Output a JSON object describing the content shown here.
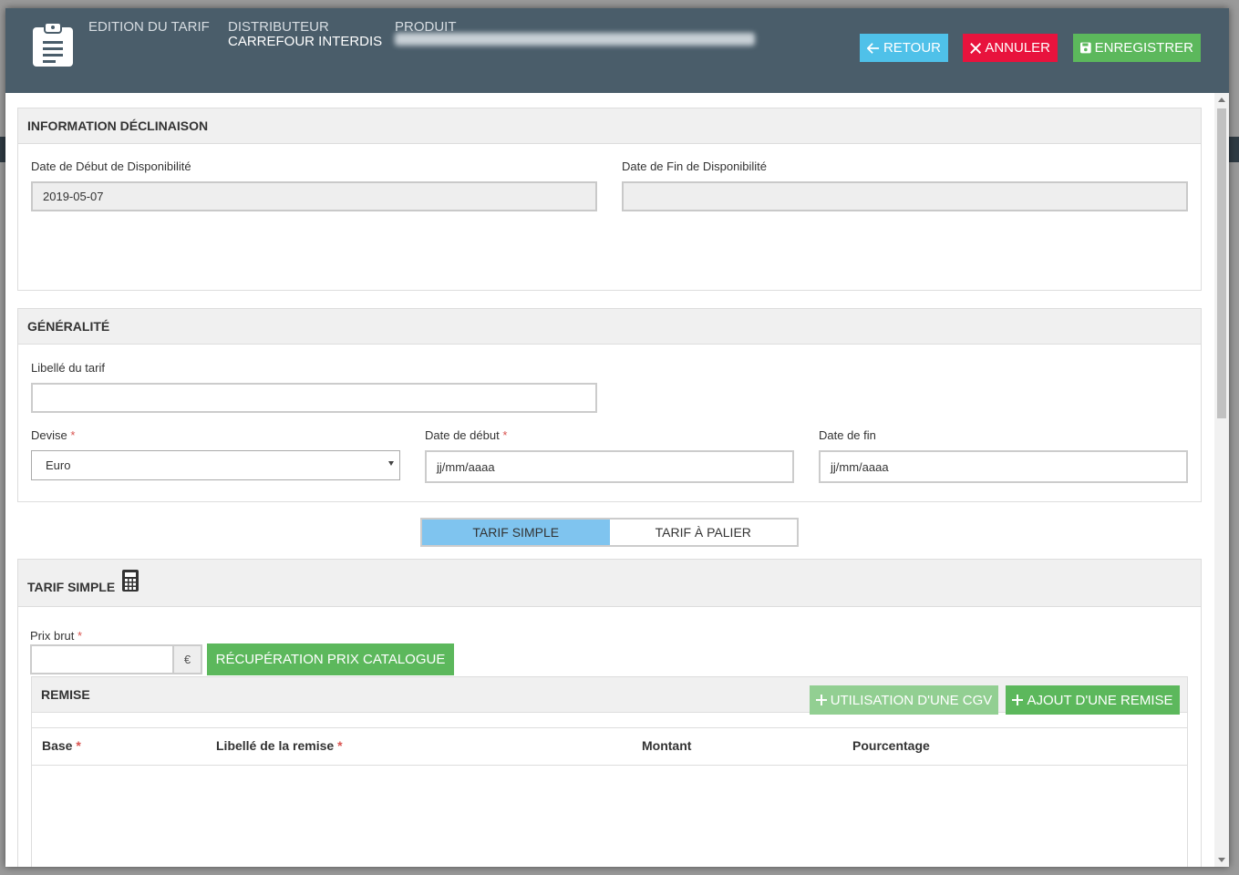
{
  "header": {
    "edition_label": "EDITION DU TARIF",
    "distributeur_label": "DISTRIBUTEUR",
    "distributeur_value": "CARREFOUR INTERDIS",
    "produit_label": "PRODUIT",
    "produit_value": "",
    "buttons": {
      "retour": "RETOUR",
      "annuler": "ANNULER",
      "enregistrer": "ENREGISTRER"
    },
    "colors": {
      "bar": "#4a5d6a",
      "retour": "#4fc1e9",
      "annuler": "#e8133d",
      "enregistrer": "#5cb85c"
    }
  },
  "info_panel": {
    "title": "INFORMATION DÉCLINAISON",
    "date_debut_label": "Date de Début de Disponibilité",
    "date_debut_value": "2019-05-07",
    "date_fin_label": "Date de Fin de Disponibilité",
    "date_fin_value": ""
  },
  "general_panel": {
    "title": "GÉNÉRALITÉ",
    "libelle_label": "Libellé du tarif",
    "libelle_value": "",
    "devise_label": "Devise",
    "devise_value": "Euro",
    "date_debut_label": "Date de début",
    "date_debut_value": "jj/mm/aaaa",
    "date_fin_label": "Date de fin",
    "date_fin_value": "jj/mm/aaaa",
    "required_marker": "*"
  },
  "tabs": [
    {
      "label": "TARIF SIMPLE",
      "active": true
    },
    {
      "label": "TARIF À PALIER",
      "active": false
    }
  ],
  "tarif_simple": {
    "title": "TARIF SIMPLE",
    "prix_brut_label": "Prix brut",
    "prix_brut_value": "",
    "currency": "€",
    "catalogue_button": "RÉCUPÉRATION PRIX CATALOGUE",
    "remise": {
      "title": "REMISE",
      "cgv_button": "UTILISATION D'UNE CGV",
      "ajout_button": "AJOUT D'UNE REMISE",
      "columns": [
        {
          "label": "Base",
          "required": true
        },
        {
          "label": "Libellé de la remise",
          "required": true
        },
        {
          "label": "Montant",
          "required": false
        },
        {
          "label": "Pourcentage",
          "required": false
        }
      ]
    }
  }
}
